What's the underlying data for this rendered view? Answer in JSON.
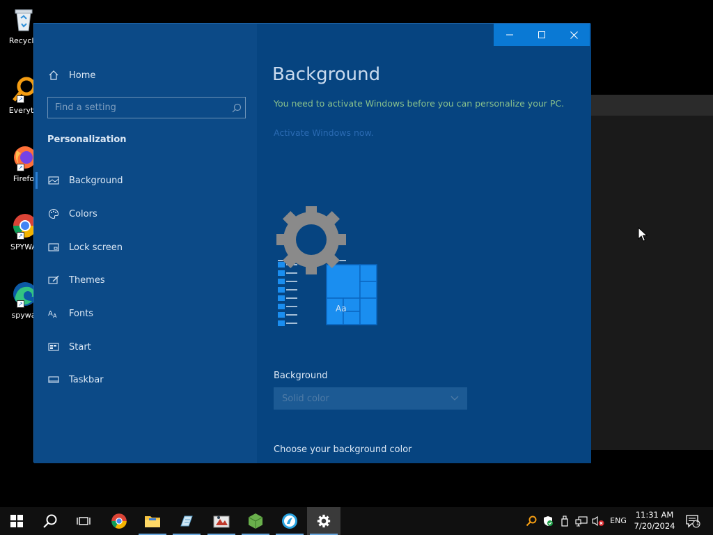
{
  "desktop": {
    "icons": [
      {
        "label": "Recycle"
      },
      {
        "label": "Everyth"
      },
      {
        "label": "Firefo"
      },
      {
        "label": "SPYWA"
      },
      {
        "label": "spywa"
      }
    ]
  },
  "settings": {
    "sidebar": {
      "home_label": "Home",
      "search_placeholder": "Find a setting",
      "section_title": "Personalization",
      "items": [
        {
          "label": "Background",
          "icon": "image-icon",
          "active": true
        },
        {
          "label": "Colors",
          "icon": "palette-icon"
        },
        {
          "label": "Lock screen",
          "icon": "lock-screen-icon"
        },
        {
          "label": "Themes",
          "icon": "themes-icon"
        },
        {
          "label": "Fonts",
          "icon": "fonts-icon"
        },
        {
          "label": "Start",
          "icon": "start-icon"
        },
        {
          "label": "Taskbar",
          "icon": "taskbar-icon"
        }
      ]
    },
    "main": {
      "title": "Background",
      "activation_notice": "You need to activate Windows before you can personalize your PC.",
      "activate_link": "Activate Windows now.",
      "preview_tile_label": "Aa",
      "background_label": "Background",
      "background_value": "Solid color",
      "choose_color_label": "Choose your background color"
    }
  },
  "taskbar": {
    "apps": [
      "start",
      "search",
      "task-view",
      "chrome",
      "file-explorer",
      "app-1",
      "app-2",
      "app-3",
      "app-4",
      "settings"
    ],
    "language": "ENG",
    "time": "11:31 AM",
    "date": "7/20/2024",
    "notification_count": "1"
  },
  "colors": {
    "accent": "#0a79d4",
    "window_bg": "#064480",
    "sidebar_bg": "#0c4a87",
    "notice_text": "#8ac28c",
    "link_text": "#2a6ab2"
  }
}
